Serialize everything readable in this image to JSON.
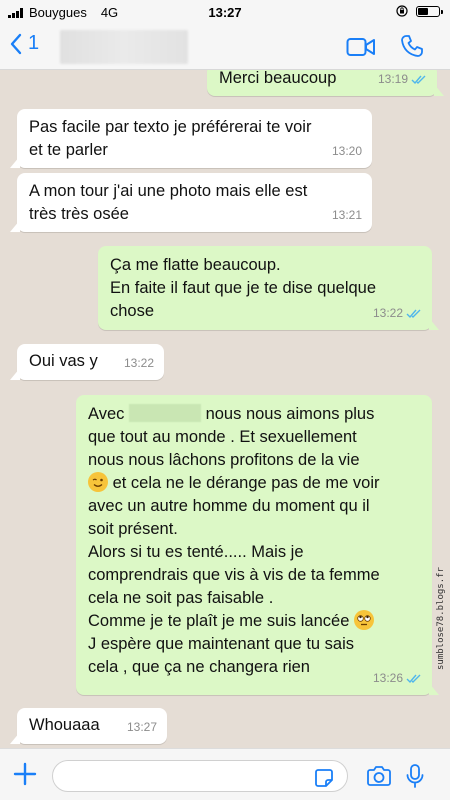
{
  "status_bar": {
    "carrier": "Bouygues",
    "network": "4G",
    "time": "13:27"
  },
  "header": {
    "back_count": "1"
  },
  "messages": [
    {
      "direction": "out",
      "text": "Merci beaucoup",
      "time": "13:19",
      "read": true
    },
    {
      "direction": "in",
      "text": "Pas facile par texto je préférerai te voir\net te parler",
      "time": "13:20"
    },
    {
      "direction": "in",
      "text": "A mon tour j'ai une photo mais elle est\ntrès très osée",
      "time": "13:21"
    },
    {
      "direction": "out",
      "text": "Ça me flatte beaucoup.\nEn faite il faut que je te dise quelque\nchose",
      "time": "13:22",
      "read": true
    },
    {
      "direction": "in",
      "text": "Oui vas y",
      "time": "13:22"
    },
    {
      "direction": "out",
      "time": "13:26",
      "read": true,
      "parts": {
        "line1_pre": "Avec",
        "line1_post": "nous nous aimons plus",
        "body1": "que tout au monde . Et sexuellement\nnous nous lâchons profitons de la vie",
        "emoji1": "wink-emoji",
        "body2": " et cela ne le dérange pas de me voir\navec un autre homme du moment qu il\nsoit présent.\nAlors si tu es tenté..... Mais je\ncomprendrais que vis à vis de ta femme\ncela ne soit pas faisable .\nComme je te plaît je me suis lancée",
        "emoji2": "eye-roll-emoji",
        "body3": "J espère que maintenant que tu sais\ncela , que ça ne changera rien"
      }
    },
    {
      "direction": "in",
      "text": "Whouaaa",
      "time": "13:27"
    }
  ],
  "input": {
    "placeholder": ""
  },
  "watermark": "sumblose78.blogs.fr",
  "colors": {
    "accent": "#1a7ff7",
    "outgoing": "#dcf8c6",
    "incoming": "#ffffff",
    "background": "#e5ddd5"
  }
}
